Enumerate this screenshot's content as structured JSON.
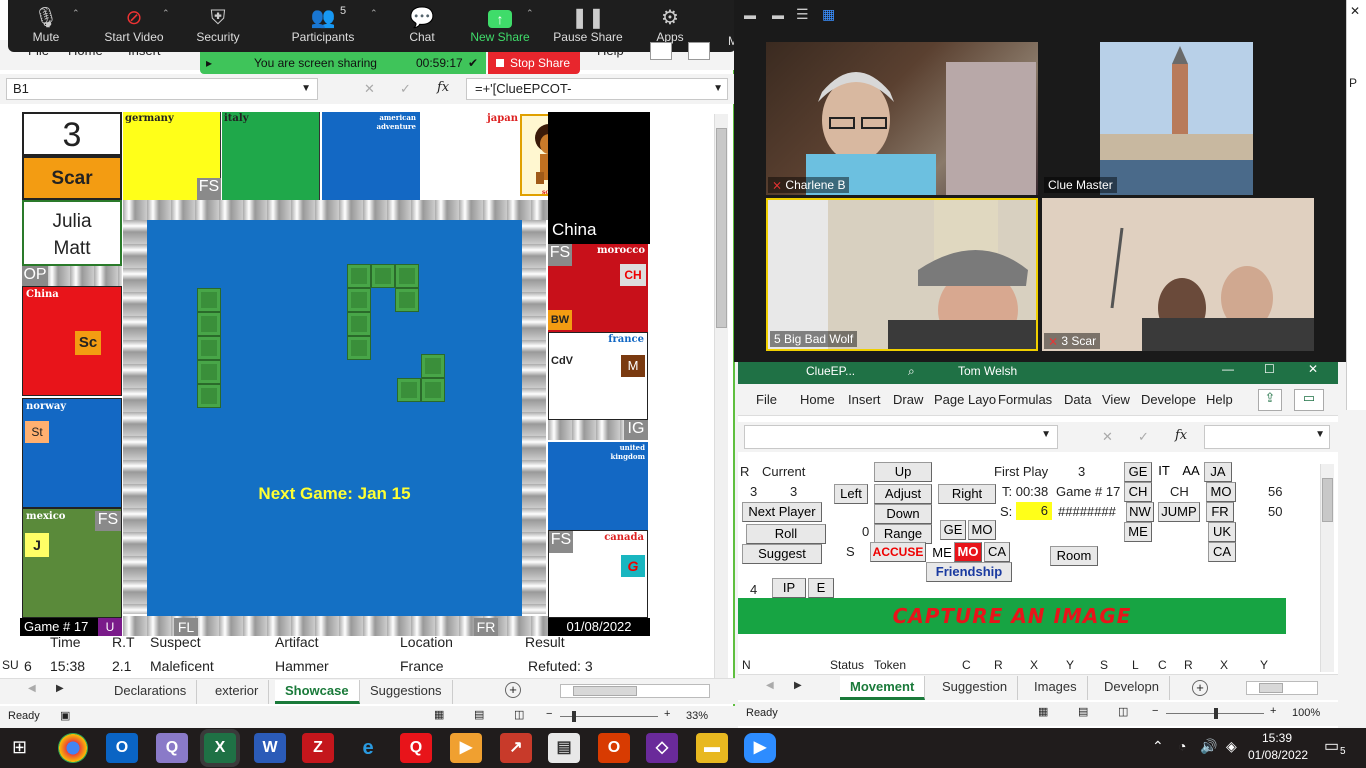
{
  "zoom_toolbar": {
    "items": [
      {
        "label": "Mute",
        "icon": "microphone-icon"
      },
      {
        "label": "Start Video",
        "icon": "video-off-icon"
      },
      {
        "label": "Security",
        "icon": "shield-icon"
      },
      {
        "label": "Participants",
        "icon": "people-icon",
        "count": "5"
      },
      {
        "label": "Chat",
        "icon": "chat-icon"
      },
      {
        "label": "New Share",
        "icon": "share-up-icon"
      },
      {
        "label": "Pause Share",
        "icon": "pause-icon"
      },
      {
        "label": "Apps",
        "icon": "apps-icon"
      }
    ],
    "sharing_text": "You are screen sharing",
    "sharing_timer": "00:59:17",
    "stop_share": "Stop Share"
  },
  "left_excel": {
    "ribbon_partial": [
      "File",
      "Home",
      "Insert",
      "Help"
    ],
    "name_box": "B1",
    "formula": "=+'[ClueEPCOT-",
    "board": {
      "counter": "3",
      "player_name": "Scar",
      "players_list": [
        "Julia",
        "Matt"
      ],
      "top_rooms": [
        "germany",
        "italy",
        "american adventure",
        "japan"
      ],
      "scar_caption": "scar",
      "china_label": "China",
      "left_rooms": [
        "China",
        "norway",
        "mexico"
      ],
      "right_rooms": [
        "morocco",
        "france",
        "united kingdom",
        "canada"
      ],
      "tags": {
        "fs": "FS",
        "op": "OP",
        "ig": "IG",
        "fl": "FL",
        "fr": "FR",
        "ch": "CH",
        "bw": "BW",
        "cdv": "CdV",
        "m": "M",
        "sc": "Sc",
        "st": "St",
        "j": "J",
        "g": "G",
        "u": "U"
      },
      "center_text": "Next Game: Jan 15",
      "game_no": "Game # 17",
      "date": "01/08/2022"
    },
    "table_headers": [
      "Time",
      "R.T",
      "Suspect",
      "Artifact",
      "Location",
      "Result"
    ],
    "table_row": {
      "prefix": "SU",
      "num": "6",
      "time": "15:38",
      "rt": "2.1",
      "suspect": "Maleficent",
      "artifact": "Hammer",
      "location": "France",
      "result": "Refuted: 3"
    },
    "sheet_tabs": [
      "Declarations",
      "exterior",
      "Showcase",
      "Suggestions"
    ],
    "active_tab": "Showcase",
    "status": "Ready",
    "zoom": "33%"
  },
  "zoom_gallery": {
    "tiles": [
      {
        "name": "Charlene B",
        "muted": true
      },
      {
        "name": "Clue Master",
        "muted": false
      },
      {
        "name": "5 Big Bad Wolf",
        "muted": false
      },
      {
        "name": "3 Scar",
        "muted": true
      }
    ]
  },
  "right_excel": {
    "title": "ClueEP...",
    "user": "Tom Welsh",
    "ribbon": [
      "File",
      "Home",
      "Insert",
      "Draw",
      "Page Layo",
      "Formulas",
      "Data",
      "View",
      "Develope",
      "Help"
    ],
    "panel": {
      "r_label": "R",
      "current_label": "Current",
      "up": "Up",
      "first_play_label": "First Play",
      "first_play_value": "3",
      "row2_a": "3",
      "row2_b": "3",
      "left": "Left",
      "adjust": "Adjust",
      "right": "Right",
      "t_label": "T: 00:38",
      "game_label": "Game # 17",
      "next_player": "Next Player",
      "down": "Down",
      "s_label": "S:",
      "s_value": "6",
      "hashes": "########",
      "roll": "Roll",
      "zero": "0",
      "range": "Range",
      "suggest": "Suggest",
      "s_small": "S",
      "accuse": "ACCUSE",
      "ge": "GE",
      "mo": "MO",
      "me": "ME",
      "mo_red": "MO",
      "ca": "CA",
      "friendship": "Friendship",
      "room": "Room",
      "top_codes": [
        "GE",
        "IT",
        "AA",
        "JA"
      ],
      "ch_btn": "CH",
      "ch_text": "CH",
      "mo_btn": "MO",
      "n56": "56",
      "nw": "NW",
      "jump": "JUMP",
      "fr": "FR",
      "n50": "50",
      "me_btn": "ME",
      "uk": "UK",
      "ca_btn": "CA",
      "four": "4",
      "ip": "IP",
      "e": "E",
      "capture": "CAPTURE AN IMAGE",
      "bottom_headers": [
        "N",
        "Status",
        "Token",
        "C",
        "R",
        "X",
        "Y",
        "S",
        "L",
        "C",
        "R",
        "X",
        "Y"
      ]
    },
    "sheet_tabs": [
      "Movement",
      "Suggestion",
      "Images",
      "Developn"
    ],
    "active_tab": "Movement",
    "status": "Ready",
    "zoom": "100%"
  },
  "taskbar": {
    "time": "15:39",
    "date": "01/08/2022",
    "notif_count": "5",
    "apps": [
      "windows-start-icon",
      "chrome-icon",
      "outlook-icon",
      "app-icon",
      "excel-icon",
      "word-icon",
      "filezilla-icon",
      "ie-icon",
      "quicken-icon",
      "media-icon",
      "red-app-icon",
      "file-icon",
      "office-icon",
      "vs-icon",
      "folder-icon",
      "zoom-icon"
    ]
  }
}
